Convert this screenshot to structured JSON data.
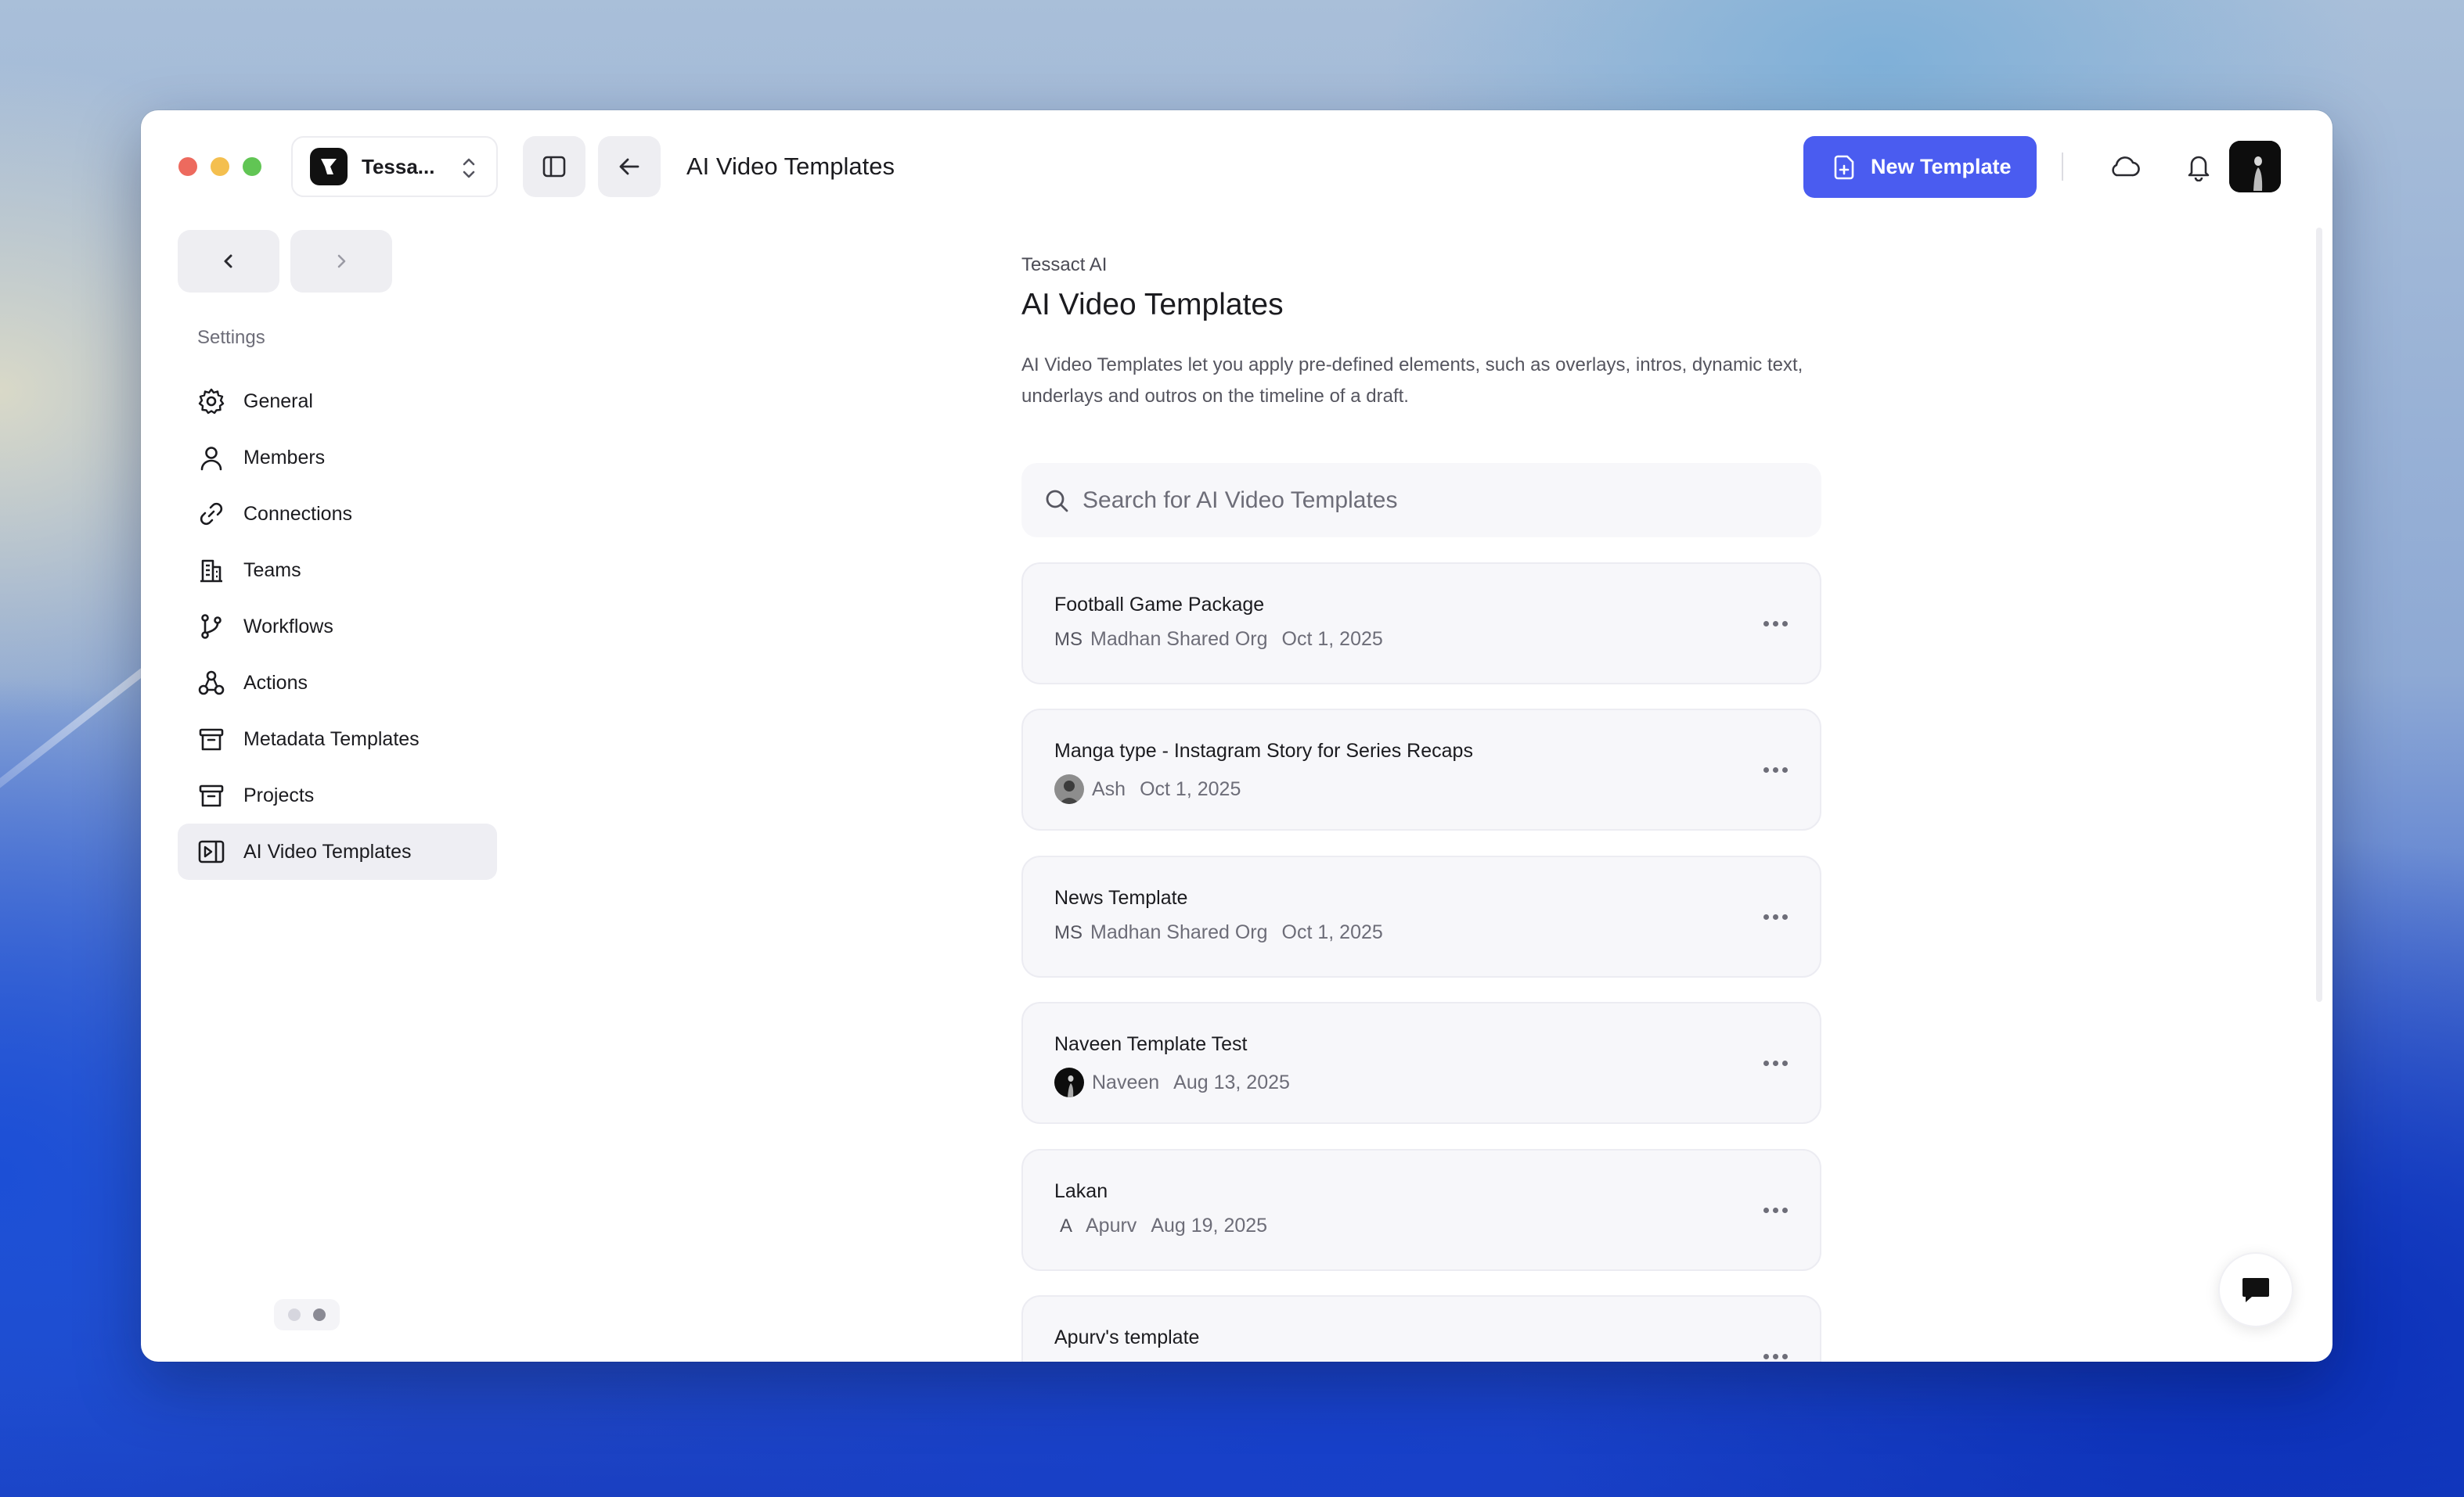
{
  "header": {
    "workspace_name": "Tessa...",
    "title": "AI Video Templates",
    "new_template_label": "New Template"
  },
  "sidebar": {
    "section_label": "Settings",
    "items": [
      {
        "label": "General",
        "icon": "gear-icon"
      },
      {
        "label": "Members",
        "icon": "user-icon"
      },
      {
        "label": "Connections",
        "icon": "link-icon"
      },
      {
        "label": "Teams",
        "icon": "building-icon"
      },
      {
        "label": "Workflows",
        "icon": "git-branch-icon"
      },
      {
        "label": "Actions",
        "icon": "nodes-icon"
      },
      {
        "label": "Metadata Templates",
        "icon": "archive-icon"
      },
      {
        "label": "Projects",
        "icon": "archive-icon"
      },
      {
        "label": "AI Video Templates",
        "icon": "video-template-icon",
        "active": true
      }
    ]
  },
  "main": {
    "org": "Tessact AI",
    "title": "AI Video Templates",
    "description": "AI Video Templates let you apply pre-defined elements, such as overlays, intros, dynamic text, underlays and outros on the timeline of a draft.",
    "search_placeholder": "Search for AI Video Templates",
    "templates": [
      {
        "title": "Football Game Package",
        "initials": "MS",
        "owner": "Madhan Shared Org",
        "date": "Oct 1, 2025"
      },
      {
        "title": "Manga type - Instagram Story for Series Recaps",
        "initials": "",
        "owner": "Ash",
        "date": "Oct 1, 2025"
      },
      {
        "title": "News Template",
        "initials": "MS",
        "owner": "Madhan Shared Org",
        "date": "Oct 1, 2025"
      },
      {
        "title": "Naveen Template Test",
        "initials": "",
        "owner": "Naveen",
        "date": "Aug 13, 2025"
      },
      {
        "title": "Lakan",
        "initials": "A",
        "owner": "Apurv",
        "date": "Aug 19, 2025"
      },
      {
        "title": "Apurv's template",
        "initials": "",
        "owner": "",
        "date": ""
      }
    ]
  },
  "colors": {
    "accent": "#4a5cf0",
    "card_bg": "#f7f7fa",
    "active_nav_bg": "#eeeef3"
  }
}
